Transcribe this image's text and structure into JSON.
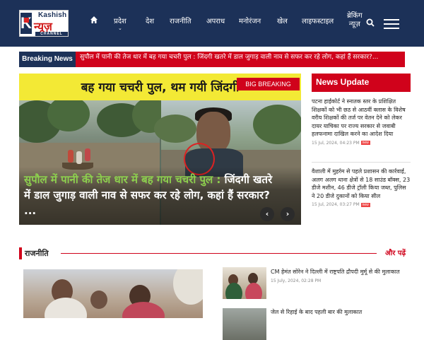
{
  "logo": {
    "english": "Kashish",
    "hindi": "न्यूज़",
    "channel": "CHANNEL"
  },
  "nav": {
    "home_icon": "home-icon",
    "items": [
      "प्रदेश",
      "देश",
      "राजनीति",
      "अपराध",
      "मनोरंजन",
      "खेल",
      "लाइफस्टाइल"
    ],
    "breaking_line1": "ब्रेकिंग",
    "breaking_line2": "न्यूज़",
    "search_icon": "search-icon",
    "menu_icon": "hamburger-menu-icon"
  },
  "breaking": {
    "label": "Breaking News",
    "text": "सुपौल में पानी की तेज धार में बह गया चचरी पुल : जिंदगी खतरे में डाल जुगाड़ वाली नाव से सफर कर रहे लोग, कहां हैं सरकार?..."
  },
  "hero": {
    "banner_text": "बह गया चचरी पुल, थम गयी जिंदगी",
    "badge": "BIG BREAKING",
    "caption_highlight": "सुपौल में पानी की तेज धार में बह गया चचरी पुल :",
    "caption_rest": " जिंदगी खतरे में डाल जुगाड़ वाली नाव से सफर कर रहे लोग, कहां हैं सरकार? ...",
    "prev_icon": "‹",
    "next_icon": "›"
  },
  "news_update": {
    "title": "News Update",
    "items": [
      {
        "text": "पटना हाईकोर्ट ने स्नातक स्तर के प्रशिक्षित शिक्षकों को भी छठ से आठवीं क्लास के विशेष वरीय शिक्षकों की तर्ज पर वेतन देने को लेकर दायर याचिका पर राज्य सरकार से जवाबी हलफनामा दाखिल करने का आदेश दिया",
        "date": "15 Jul, 2024, 04:23 PM",
        "badge": "new"
      },
      {
        "text": "वैशाली में मुहर्रम से पहले प्रशासन की कार्रवाई, अलग अलग थाना क्षेत्रों से 18 साउंड बॉक्स, 23 डीजे मशीन, 46 डीजे ट्रॉली किया जब्त, पुलिस ने 20 डीजे दुकानों को किया सील",
        "date": "15 Jul, 2024, 03:27 PM",
        "badge": "new"
      }
    ]
  },
  "rajniti": {
    "title": "राजनीति",
    "more": "और पढ़ें",
    "side_items": [
      {
        "title": "CM हेमंत सोरेन ने दिल्ली में राष्ट्रपति द्रौपदी मुर्मू से की मुलाकात",
        "date": "15 July, 2024, 02:28 PM"
      },
      {
        "title": "जेल से रिहाई के बाद पहली बार की मुलाकात",
        "date": ""
      }
    ]
  },
  "colors": {
    "navy": "#1c3158",
    "red": "#d0021b",
    "highlight_green": "#8dd04e",
    "banner_yellow": "#f3e935"
  }
}
